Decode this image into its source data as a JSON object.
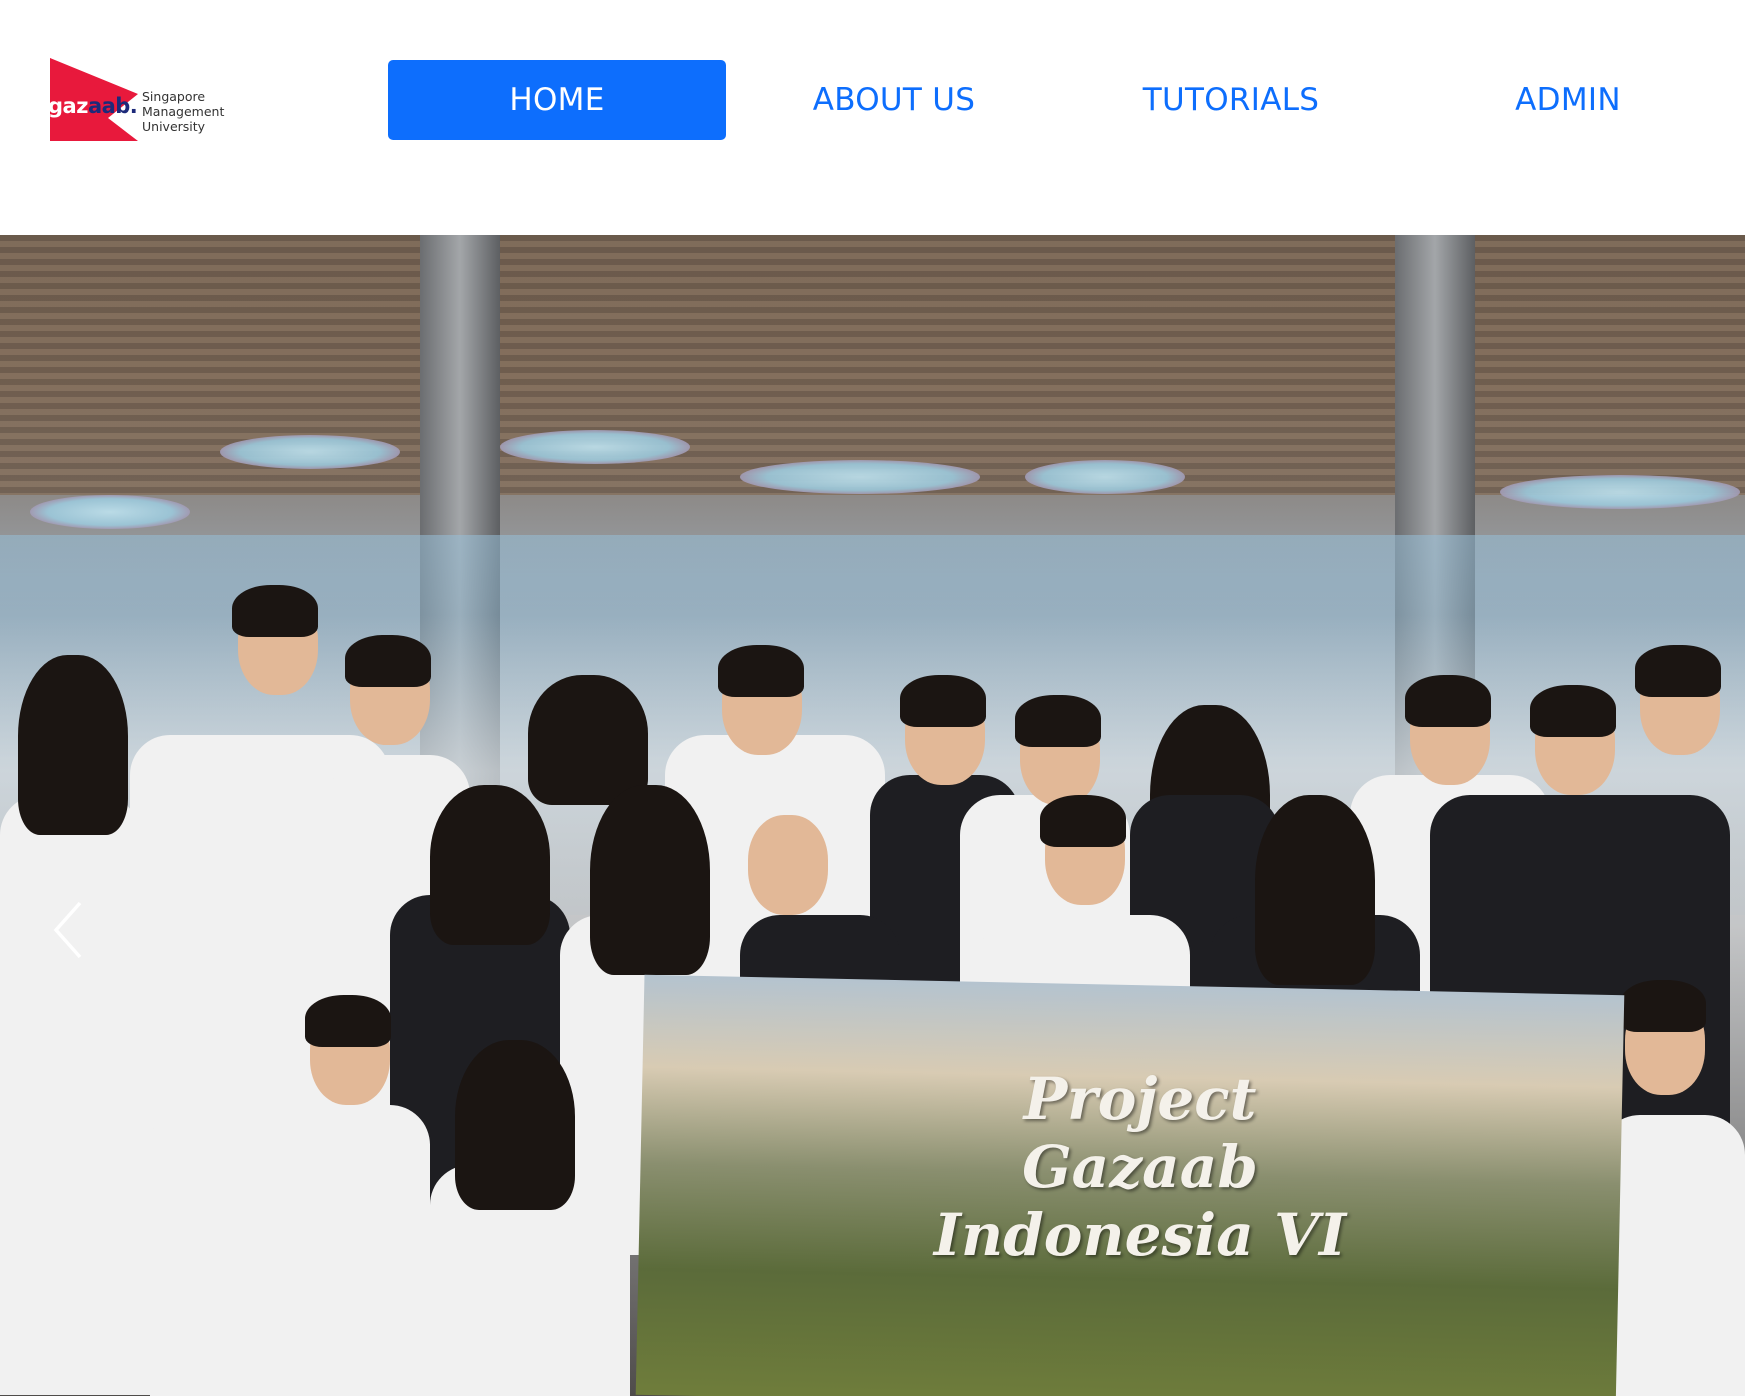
{
  "logo": {
    "word_part1": "gaz",
    "word_part2": "aab.",
    "university_line1": "Singapore",
    "university_line2": "Management",
    "university_line3": "University",
    "brand_red": "#e8193c",
    "brand_navy": "#1d2a7a"
  },
  "nav": {
    "items": [
      {
        "label": "HOME",
        "active": true
      },
      {
        "label": "ABOUT US",
        "active": false
      },
      {
        "label": "TUTORIALS",
        "active": false
      },
      {
        "label": "ADMIN",
        "active": false
      }
    ],
    "accent_color": "#0d6efd"
  },
  "hero": {
    "banner_line1": "Project",
    "banner_line2": "Gazaab",
    "banner_line3": "Indonesia VI",
    "prev_icon": "chevron-left-icon"
  }
}
